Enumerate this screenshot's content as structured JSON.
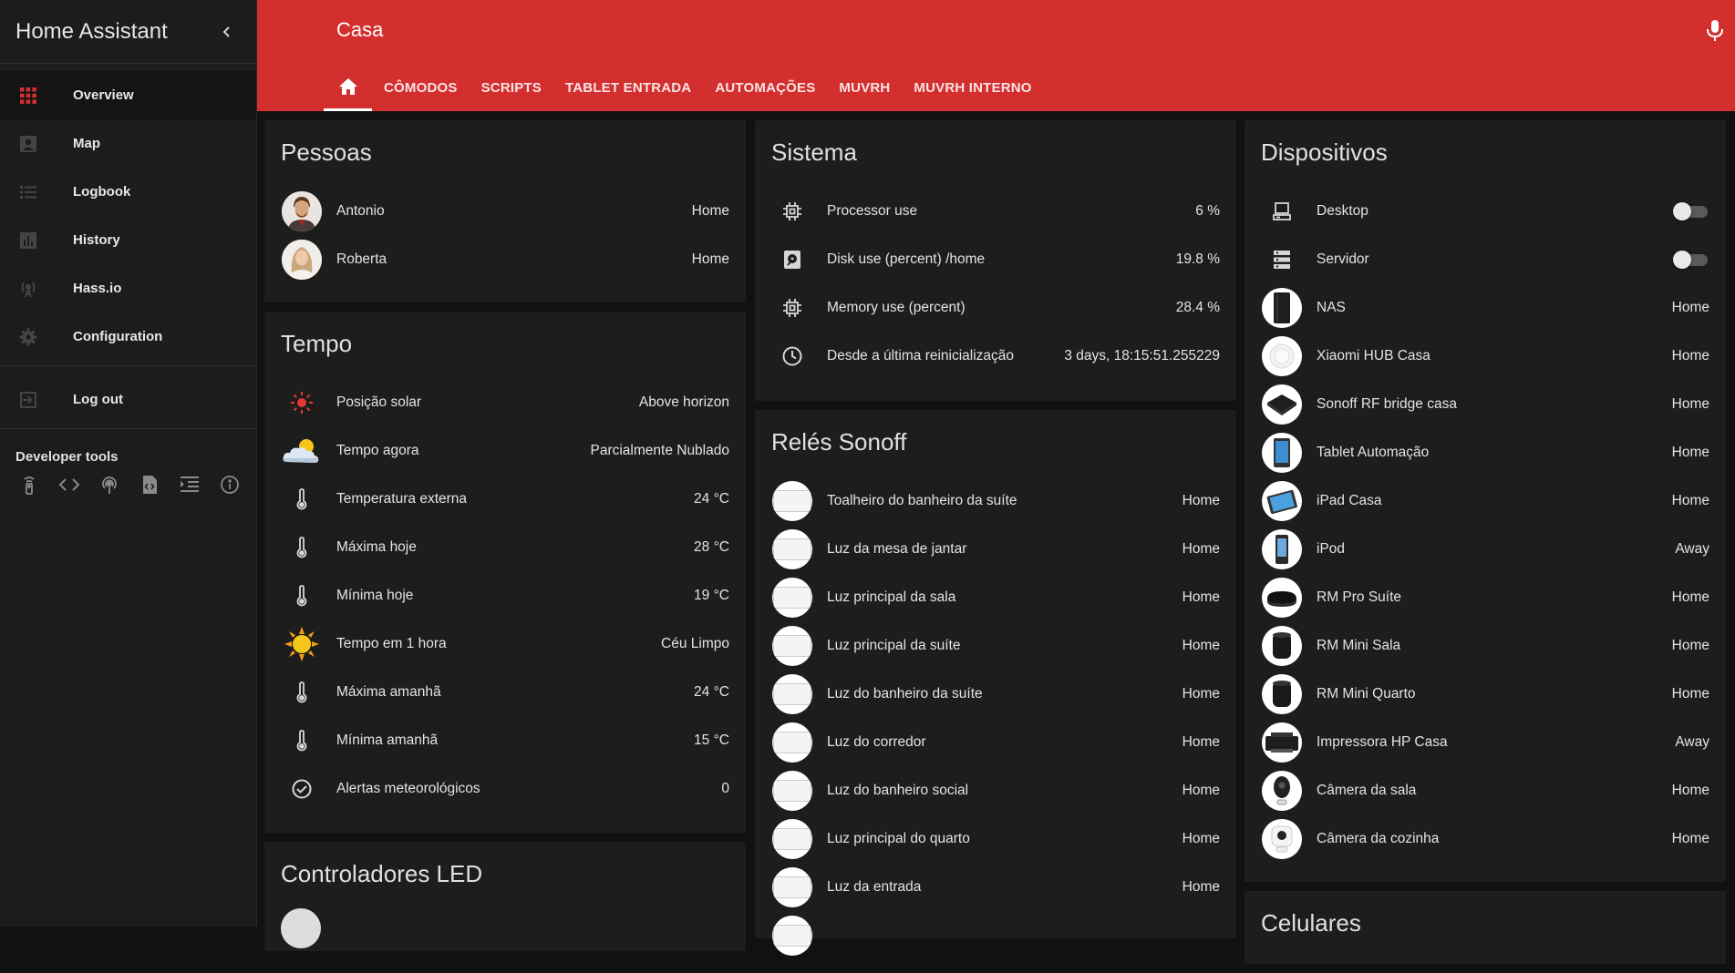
{
  "sidebar": {
    "title": "Home Assistant",
    "items": [
      {
        "label": "Overview",
        "icon": "grid-icon"
      },
      {
        "label": "Map",
        "icon": "map-account-icon"
      },
      {
        "label": "Logbook",
        "icon": "list-icon"
      },
      {
        "label": "History",
        "icon": "chart-bar-icon"
      },
      {
        "label": "Hass.io",
        "icon": "antenna-icon"
      },
      {
        "label": "Configuration",
        "icon": "gear-icon"
      }
    ],
    "logout_label": "Log out",
    "developer_tools_title": "Developer tools",
    "accent_color": "#d32f2f"
  },
  "header": {
    "title": "Casa",
    "background_color": "#d32f2f",
    "tabs": [
      "Cômodos",
      "Scripts",
      "Tablet Entrada",
      "Automações",
      "MUVRH",
      "MUVRH Interno"
    ]
  },
  "cards": {
    "pessoas": {
      "title": "Pessoas",
      "rows": [
        {
          "name": "Antonio",
          "value": "Home"
        },
        {
          "name": "Roberta",
          "value": "Home"
        }
      ]
    },
    "tempo": {
      "title": "Tempo",
      "rows": [
        {
          "name": "Posição solar",
          "value": "Above horizon",
          "icon": "sun-icon"
        },
        {
          "name": "Tempo agora",
          "value": "Parcialmente Nublado",
          "icon": "partly-cloudy-icon"
        },
        {
          "name": "Temperatura externa",
          "value": "24 °C",
          "icon": "thermometer-icon"
        },
        {
          "name": "Máxima hoje",
          "value": "28 °C",
          "icon": "thermometer-icon"
        },
        {
          "name": "Mínima hoje",
          "value": "19 °C",
          "icon": "thermometer-icon"
        },
        {
          "name": "Tempo em 1 hora",
          "value": "Céu Limpo",
          "icon": "sunny-icon"
        },
        {
          "name": "Máxima amanhã",
          "value": "24 °C",
          "icon": "thermometer-icon"
        },
        {
          "name": "Mínima amanhã",
          "value": "15 °C",
          "icon": "thermometer-icon"
        },
        {
          "name": "Alertas meteorológicos",
          "value": "0",
          "icon": "check-circle-icon"
        }
      ]
    },
    "controladores": {
      "title": "Controladores LED"
    },
    "sistema": {
      "title": "Sistema",
      "rows": [
        {
          "name": "Processor use",
          "value": "6 %",
          "icon": "chip-icon"
        },
        {
          "name": "Disk use (percent) /home",
          "value": "19.8 %",
          "icon": "harddisk-icon"
        },
        {
          "name": "Memory use (percent)",
          "value": "28.4 %",
          "icon": "chip-icon"
        },
        {
          "name": "Desde a última reinicialização",
          "value": "3 days, 18:15:51.255229",
          "icon": "clock-icon"
        }
      ]
    },
    "reles": {
      "title": "Relés Sonoff",
      "rows": [
        {
          "name": "Toalheiro do banheiro da suíte",
          "value": "Home"
        },
        {
          "name": "Luz da mesa de jantar",
          "value": "Home"
        },
        {
          "name": "Luz principal da sala",
          "value": "Home"
        },
        {
          "name": "Luz principal da suíte",
          "value": "Home"
        },
        {
          "name": "Luz do banheiro da suíte",
          "value": "Home"
        },
        {
          "name": "Luz do corredor",
          "value": "Home"
        },
        {
          "name": "Luz do banheiro social",
          "value": "Home"
        },
        {
          "name": "Luz principal do quarto",
          "value": "Home"
        },
        {
          "name": "Luz da entrada",
          "value": "Home"
        }
      ]
    },
    "dispositivos": {
      "title": "Dispositivos",
      "rows": [
        {
          "name": "Desktop",
          "value": "",
          "icon": "desktop-icon",
          "toggle": true
        },
        {
          "name": "Servidor",
          "value": "",
          "icon": "server-icon",
          "toggle": true
        },
        {
          "name": "NAS",
          "value": "Home",
          "icon": "nas-icon"
        },
        {
          "name": "Xiaomi HUB Casa",
          "value": "Home",
          "icon": "hub-icon"
        },
        {
          "name": "Sonoff RF bridge casa",
          "value": "Home",
          "icon": "rf-bridge-icon"
        },
        {
          "name": "Tablet Automação",
          "value": "Home",
          "icon": "tablet-icon"
        },
        {
          "name": "iPad Casa",
          "value": "Home",
          "icon": "ipad-icon"
        },
        {
          "name": "iPod",
          "value": "Away",
          "icon": "ipod-icon"
        },
        {
          "name": "RM Pro Suíte",
          "value": "Home",
          "icon": "rm-pro-icon"
        },
        {
          "name": "RM Mini Sala",
          "value": "Home",
          "icon": "rm-mini-icon"
        },
        {
          "name": "RM Mini Quarto",
          "value": "Home",
          "icon": "rm-mini-icon"
        },
        {
          "name": "Impressora HP Casa",
          "value": "Away",
          "icon": "printer-icon"
        },
        {
          "name": "Câmera da sala",
          "value": "Home",
          "icon": "camera-icon"
        },
        {
          "name": "Câmera da cozinha",
          "value": "Home",
          "icon": "camera-icon"
        }
      ]
    },
    "celulares": {
      "title": "Celulares"
    }
  }
}
